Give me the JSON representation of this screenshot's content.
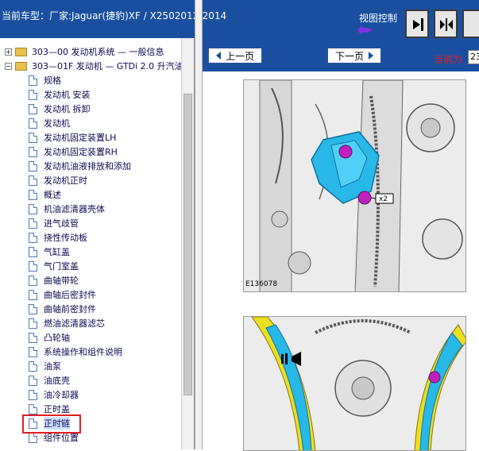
{
  "header": {
    "title": "当前车型：厂家:Jaguar(捷豹)XF / X2502012-2014",
    "view_control_label": "视图控制"
  },
  "nav": {
    "prev_label": "上一页",
    "next_label": "下一页",
    "current_label": "当前为",
    "current_value": "23"
  },
  "tree": {
    "group_items": [
      {
        "label": "303—00 发动机系统 — 一般信息",
        "expanded": false
      },
      {
        "label": "303—01F 发动机 — GTDi 2.0 升汽油",
        "expanded": true
      }
    ],
    "doc_items": [
      "规格",
      "发动机 安装",
      "发动机 拆卸",
      "发动机",
      "发动机固定装置LH",
      "发动机固定装置RH",
      "发动机油液排放和添加",
      "发动机正时",
      "概述",
      "机油滤清器壳体",
      "进气歧管",
      "挠性传动板",
      "气缸盖",
      "气门室盖",
      "曲轴带轮",
      "曲轴后密封件",
      "曲轴前密封件",
      "燃油滤清器滤芯",
      "凸轮轴",
      "系统操作和组件说明",
      "油泵",
      "油底壳",
      "油冷却器",
      "正时盖",
      "正时链",
      "组件位置"
    ],
    "selected_item": "正时链"
  },
  "figures": {
    "fig1_code": "E136078",
    "fig1_callout": "x2"
  },
  "colors": {
    "header_bg": "#1a4fa0",
    "highlight": "#e02020",
    "tensioner": "#28b8e8",
    "bolt": "#c020c0",
    "guide": "#e8e020"
  }
}
